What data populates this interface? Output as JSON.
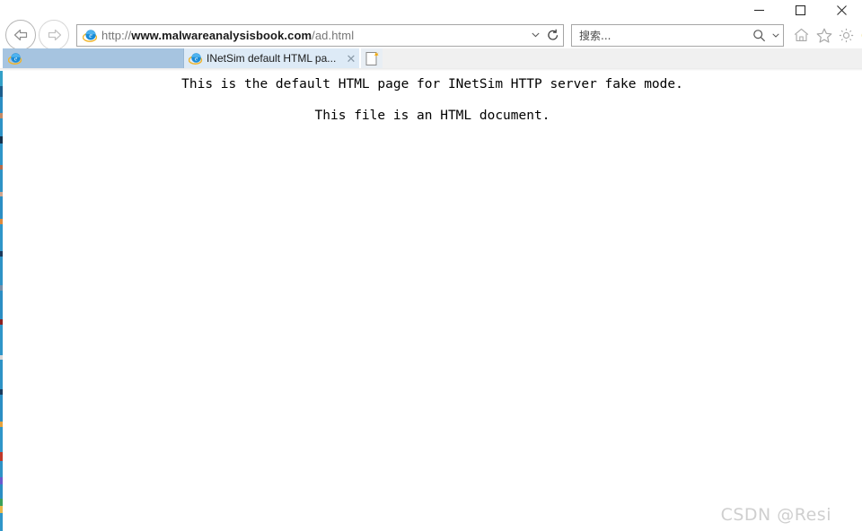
{
  "window": {
    "controls": [
      {
        "name": "minimize-button",
        "glyph": "minimize"
      },
      {
        "name": "maximize-button",
        "glyph": "maximize"
      },
      {
        "name": "close-button",
        "glyph": "close"
      }
    ]
  },
  "navigation": {
    "back_label": "Back",
    "forward_label": "Forward",
    "address": {
      "scheme": "http://",
      "host": "www.malwareanalysisbook.com",
      "path": "/ad.html",
      "full_url": "http://www.malwareanalysisbook.com/ad.html",
      "favicon": "internet-explorer-icon",
      "dropdown_label": "▾",
      "refresh_label": "Refresh"
    },
    "search": {
      "placeholder": "搜索...",
      "value": "",
      "icon": "search-icon",
      "caret": "▾"
    },
    "command_icons": [
      {
        "name": "home-icon",
        "label": "Home"
      },
      {
        "name": "favorites-star-icon",
        "label": "Favorites"
      },
      {
        "name": "tools-gear-icon",
        "label": "Tools"
      },
      {
        "name": "feedback-smiley-icon",
        "label": "Feedback"
      }
    ]
  },
  "tabs": {
    "active_tab": {
      "title": "INetSim default HTML pa...",
      "favicon": "internet-explorer-icon",
      "close_label": "✕"
    },
    "new_tab_label": "New tab"
  },
  "page": {
    "lines": [
      "This is the default HTML page for INetSim HTTP server fake mode.",
      "This file is an HTML document."
    ]
  },
  "watermark": {
    "text": "CSDN @Resi"
  },
  "colors": {
    "tab_band": "#a6c4e0",
    "active_tab": "#ddeaf6",
    "chrome_bg": "#ffffff",
    "watermark": "#cfcfcf",
    "smiley": "#f0c419"
  }
}
